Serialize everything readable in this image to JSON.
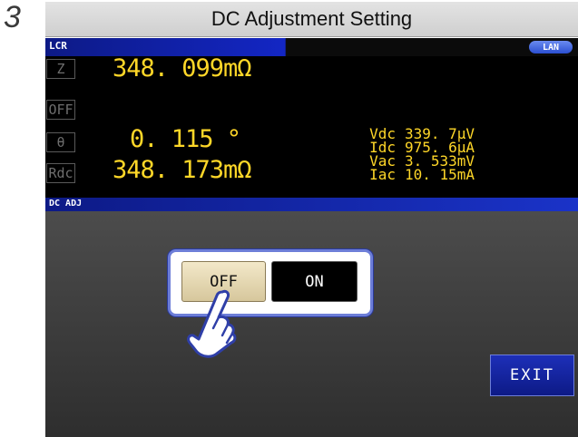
{
  "step": {
    "number": "3"
  },
  "title_bar": {
    "title": "DC Adjustment Setting"
  },
  "top_bar": {
    "label": "LCR",
    "badge": "LAN"
  },
  "params": [
    {
      "name": "Z"
    },
    {
      "name": "OFF"
    },
    {
      "name": "θ"
    },
    {
      "name": "Rdc"
    }
  ],
  "readings": {
    "z": "348. 099mΩ",
    "theta": "0. 115 °",
    "rdc": "348. 173mΩ"
  },
  "monitor": [
    {
      "label": "Vdc",
      "value": "339. 7μV"
    },
    {
      "label": "Idc",
      "value": "975. 6μA"
    },
    {
      "label": "Vac",
      "value": "3. 533mV"
    },
    {
      "label": "Iac",
      "value": "10. 15mA"
    }
  ],
  "section": {
    "label": "DC ADJ"
  },
  "toggle": {
    "off_label": "OFF",
    "on_label": "ON",
    "selected": "OFF"
  },
  "exit_label": "EXIT",
  "colors": {
    "reading": "#ffd728",
    "bar_blue": "#1326c4",
    "selected_button": "#f3e8c9",
    "frame_blue": "#6d7ed8"
  },
  "icons": {
    "pointer": "pointing-hand-icon",
    "badge": "lan-badge"
  }
}
